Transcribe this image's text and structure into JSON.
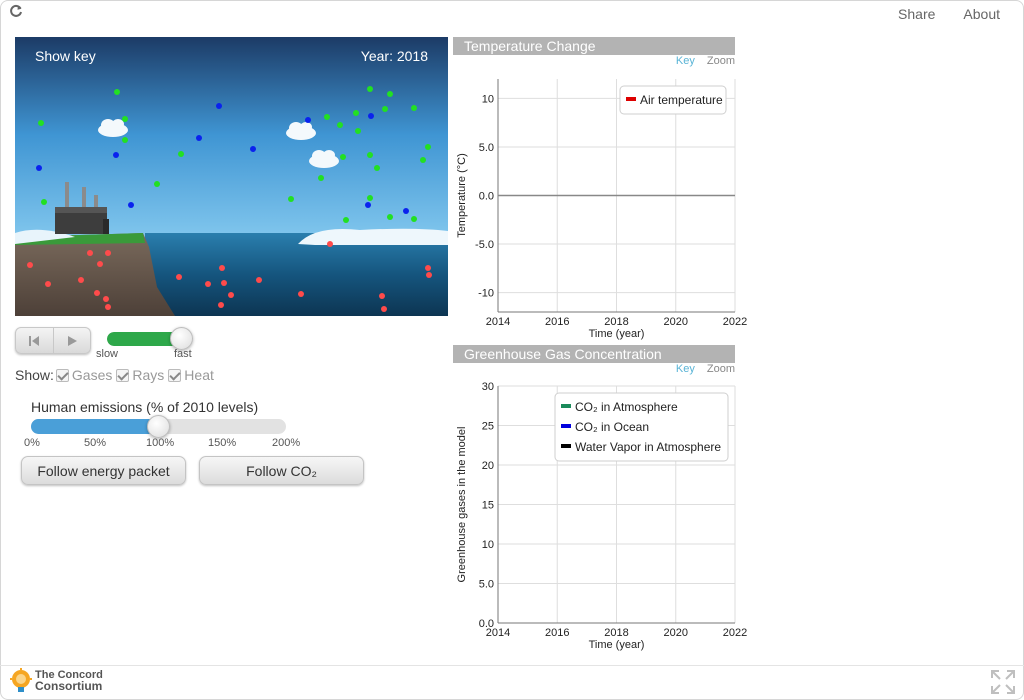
{
  "topbar": {
    "share_label": "Share",
    "about_label": "About",
    "reload_icon": "reload-icon"
  },
  "model": {
    "show_key_label": "Show key",
    "year_label": "Year: 2018"
  },
  "playback": {
    "reset_icon": "reset-icon",
    "play_icon": "play-icon",
    "speed_slow_label": "slow",
    "speed_fast_label": "fast",
    "speed_level": 0.88
  },
  "show_options": {
    "label": "Show:",
    "items": [
      {
        "label": "Gases",
        "checked": true
      },
      {
        "label": "Rays",
        "checked": true
      },
      {
        "label": "Heat",
        "checked": true
      }
    ]
  },
  "emissions": {
    "title": "Human emissions (% of 2010 levels)",
    "value_percent": 100,
    "max_percent": 200,
    "ticks": [
      "0%",
      "50%",
      "100%",
      "150%",
      "200%"
    ]
  },
  "buttons": {
    "follow_energy": "Follow energy packet",
    "follow_co2": "Follow CO₂"
  },
  "temp_graph": {
    "title": "Temperature Change",
    "key_label": "Key",
    "zoom_label": "Zoom"
  },
  "ghg_graph": {
    "title": "Greenhouse Gas Concentration",
    "key_label": "Key",
    "zoom_label": "Zoom"
  },
  "footer": {
    "logo_line1": "The Concord",
    "logo_line2": "Consortium",
    "fullscreen_icon": "fullscreen-icon"
  },
  "colors": {
    "accent_green": "#2ea84a",
    "accent_blue": "#4a9fd8",
    "co2_atmosphere": "#1a8a5a",
    "co2_ocean": "#0000dd",
    "water_vapor": "#000000",
    "air_temperature": "#dd0000"
  },
  "chart_data": [
    {
      "type": "line",
      "title": "Temperature Change",
      "xlabel": "Time (year)",
      "ylabel": "Temperature (°C)",
      "xlim": [
        2014,
        2022
      ],
      "ylim": [
        -12,
        12
      ],
      "x_ticks": [
        "2014",
        "2016",
        "2018",
        "2020",
        "2022"
      ],
      "y_ticks": [
        "10",
        "5.0",
        "0.0",
        "-5.0",
        "-10"
      ],
      "grid": true,
      "legend_position": "top-right",
      "series": [
        {
          "name": "Air temperature",
          "color": "#dd0000",
          "x": [],
          "y": []
        }
      ]
    },
    {
      "type": "line",
      "title": "Greenhouse Gas Concentration",
      "xlabel": "Time (year)",
      "ylabel": "Greenhouse gases in the model",
      "xlim": [
        2014,
        2022
      ],
      "ylim": [
        0,
        30
      ],
      "x_ticks": [
        "2014",
        "2016",
        "2018",
        "2020",
        "2022"
      ],
      "y_ticks": [
        "30",
        "25",
        "20",
        "15",
        "10",
        "5.0",
        "0.0"
      ],
      "grid": true,
      "legend_position": "top-right",
      "series": [
        {
          "name": "CO₂ in Atmosphere",
          "color": "#1a8a5a",
          "x": [],
          "y": []
        },
        {
          "name": "CO₂ in Ocean",
          "color": "#0000dd",
          "x": [],
          "y": []
        },
        {
          "name": "Water Vapor in Atmosphere",
          "color": "#000000",
          "x": [],
          "y": []
        }
      ]
    }
  ]
}
